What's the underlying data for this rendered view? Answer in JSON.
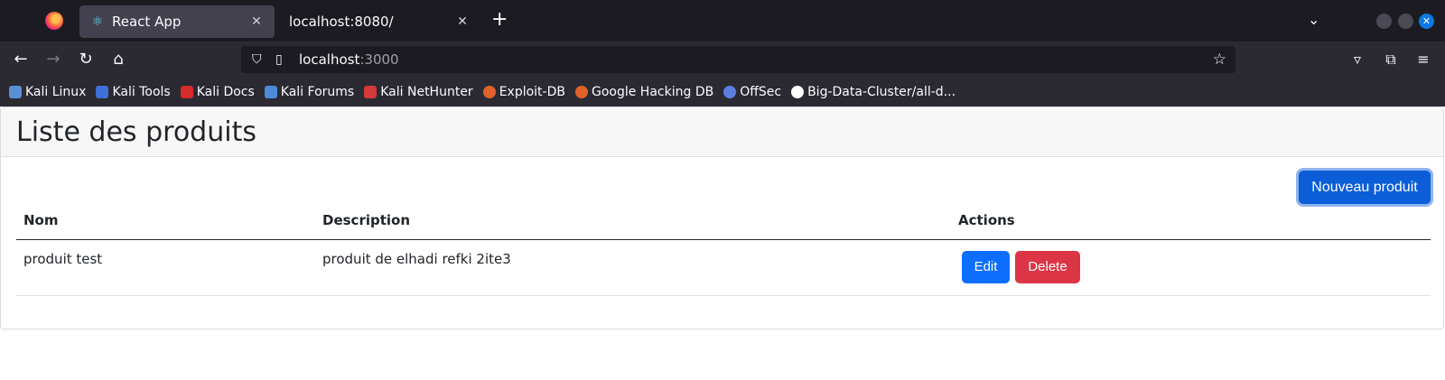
{
  "browser": {
    "tabs": [
      {
        "title": "React App",
        "active": true
      },
      {
        "title": "localhost:8080/",
        "active": false
      }
    ],
    "address": {
      "host": "localhost",
      "port": ":3000"
    },
    "bookmarks": [
      {
        "label": "Kali Linux",
        "icon": "kali-dragon-icon",
        "color": "#5a8fd6"
      },
      {
        "label": "Kali Tools",
        "icon": "kali-tools-icon",
        "color": "#3f6fd8"
      },
      {
        "label": "Kali Docs",
        "icon": "kali-docs-icon",
        "color": "#d52b2b"
      },
      {
        "label": "Kali Forums",
        "icon": "kali-forums-icon",
        "color": "#4d8bd8"
      },
      {
        "label": "Kali NetHunter",
        "icon": "nethunter-icon",
        "color": "#d43a3a"
      },
      {
        "label": "Exploit-DB",
        "icon": "exploit-db-icon",
        "color": "#e0612a"
      },
      {
        "label": "Google Hacking DB",
        "icon": "ghdb-icon",
        "color": "#e0612a"
      },
      {
        "label": "OffSec",
        "icon": "offsec-icon",
        "color": "#5b7fe0"
      },
      {
        "label": "Big-Data-Cluster/all-d...",
        "icon": "github-icon",
        "color": "#ffffff"
      }
    ]
  },
  "page": {
    "title": "Liste des produits",
    "new_button": "Nouveau produit",
    "table": {
      "headers": [
        "Nom",
        "Description",
        "Actions"
      ],
      "rows": [
        {
          "nom": "produit test",
          "description": "produit de elhadi refki 2ite3"
        }
      ],
      "edit_label": "Edit",
      "delete_label": "Delete"
    }
  },
  "colors": {
    "primary": "#0d6efd",
    "danger": "#dc3545",
    "browser_bg": "#1c1b22"
  }
}
